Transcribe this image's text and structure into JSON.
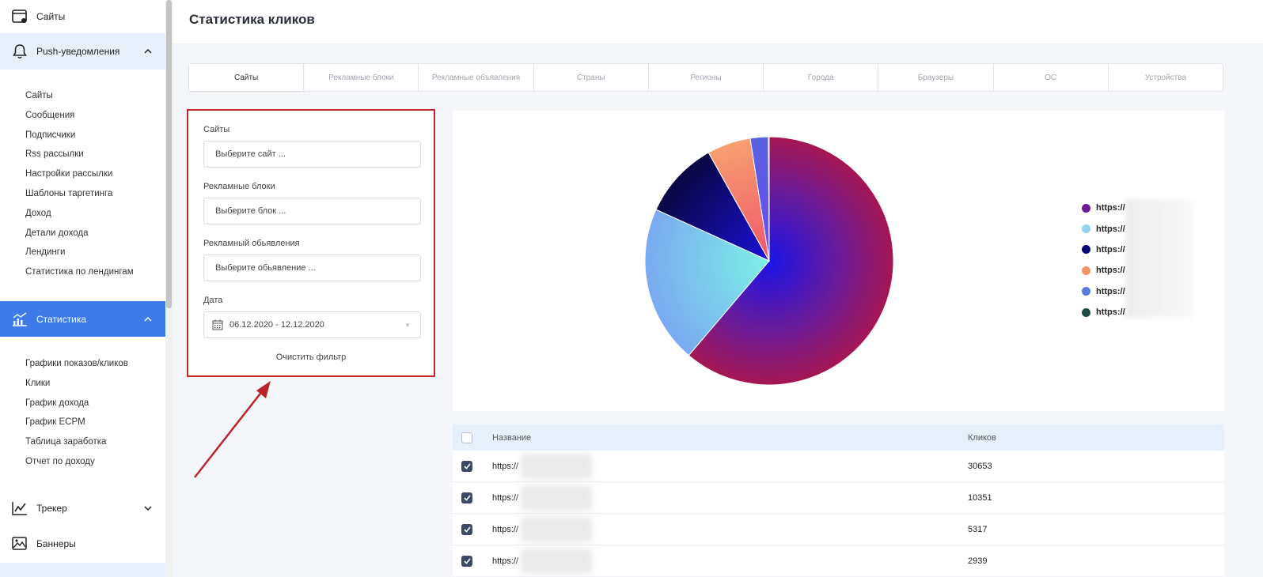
{
  "sidebar": {
    "top_item": {
      "label": "Сайты",
      "icon": "browser-window-icon"
    },
    "push": {
      "label": "Push-уведомления",
      "icon": "bell-icon",
      "expanded": true
    },
    "push_items": [
      "Сайты",
      "Сообщения",
      "Подписчики",
      "Rss рассылки",
      "Настройки рассылки",
      "Шаблоны таргетинга",
      "Доход",
      "Детали дохода",
      "Лендинги",
      "Статистика по лендингам"
    ],
    "stats": {
      "label": "Статистика",
      "icon": "chart-growth-icon",
      "expanded": true,
      "bg_color": "#3e7be8"
    },
    "stats_items": [
      "Графики показов/кликов",
      "Клики",
      "График дохода",
      "График ECPM",
      "Таблица заработка",
      "Отчет по доходу"
    ],
    "tracker": {
      "label": "Трекер",
      "icon": "line-chart-icon"
    },
    "banners": {
      "label": "Баннеры",
      "icon": "image-icon"
    }
  },
  "header": {
    "title": "Статистика кликов"
  },
  "tabs": [
    "Сайты",
    "Рекламные блоки",
    "Рекламные объявления",
    "Страны",
    "Регионы",
    "Города",
    "Браузеры",
    "ОС",
    "Устройства"
  ],
  "active_tab": 0,
  "filter": {
    "sites_label": "Сайты",
    "sites_placeholder": "Выберите сайт ...",
    "blocks_label": "Рекламные блоки",
    "blocks_placeholder": "Выберите блок ...",
    "ads_label": "Рекламный обьявления",
    "ads_placeholder": "Выберите обьявление ...",
    "date_label": "Дата",
    "date_value": "06.12.2020 - 12.12.2020",
    "clear_label": "Очистить фильтр",
    "highlight_color": "#c0282e"
  },
  "chart_data": {
    "type": "pie",
    "slices": [
      {
        "label": "https://",
        "value": 62.5,
        "color": "#9c1a5f"
      },
      {
        "label": "https://",
        "value": 21.0,
        "color": "#7ecbe9"
      },
      {
        "label": "https://",
        "value": 10.3,
        "color": "#0b0b5c"
      },
      {
        "label": "https://",
        "value": 5.8,
        "color": "#f6926a"
      },
      {
        "label": "https://",
        "value": 2.4,
        "color": "#5a62e0"
      },
      {
        "label": "https://",
        "value": 0.1,
        "color": "#1a4e47"
      }
    ],
    "legend_position": "right"
  },
  "legend": [
    {
      "label": "https://",
      "color": "#6a1b9a"
    },
    {
      "label": "https://",
      "color": "#8fd3ef"
    },
    {
      "label": "https://",
      "color": "#0b0b7a"
    },
    {
      "label": "https://",
      "color": "#f6926a"
    },
    {
      "label": "https://",
      "color": "#5a7be0"
    },
    {
      "label": "https://",
      "color": "#1a4e47"
    }
  ],
  "table": {
    "col_name": "Название",
    "col_clicks": "Кликов",
    "rows": [
      {
        "name": "https://",
        "clicks": "30653",
        "checked": true
      },
      {
        "name": "https://",
        "clicks": "10351",
        "checked": true
      },
      {
        "name": "https://",
        "clicks": "5317",
        "checked": true
      },
      {
        "name": "https://",
        "clicks": "2939",
        "checked": true
      }
    ]
  }
}
